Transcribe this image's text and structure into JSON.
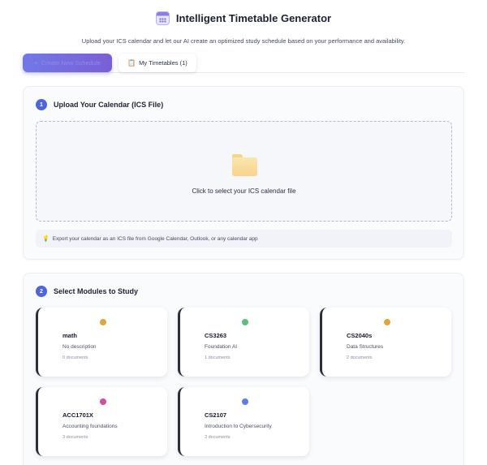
{
  "header": {
    "title": "Intelligent Timetable Generator",
    "subtitle": "Upload your ICS calendar and let our AI create an optimized study schedule based on your performance and availability."
  },
  "tabs": [
    {
      "label": "Create New Schedule",
      "icon": "plus-icon",
      "active": true
    },
    {
      "label": "My Timetables (1)",
      "icon": "clipboard-icon",
      "active": false
    }
  ],
  "upload": {
    "step": "1",
    "title": "Upload Your Calendar (ICS File)",
    "drop_label": "Click to select your ICS calendar file",
    "tip": "Export your calendar as an ICS file from Google Calendar, Outlook, or any calendar app"
  },
  "modules_section": {
    "step": "2",
    "title": "Select Modules to Study",
    "modules": [
      {
        "code": "math",
        "description": "No description",
        "documents": "0 documents",
        "color": "#e0a63a"
      },
      {
        "code": "CS3263",
        "description": "Foundation AI",
        "documents": "1 documents",
        "color": "#5fbf82"
      },
      {
        "code": "CS2040s",
        "description": "Data Structures",
        "documents": "2 documents",
        "color": "#e0a63a"
      },
      {
        "code": "ACC1701X",
        "description": "Accounting foundations",
        "documents": "3 documents",
        "color": "#d24f9c"
      },
      {
        "code": "CS2107",
        "description": "Introduction to Cybersecurity",
        "documents": "3 documents",
        "color": "#5b7fe6"
      }
    ]
  },
  "colors": {
    "accent": "#4e63dc",
    "tab_gradient_start": "#7278e6",
    "tab_gradient_end": "#7a5fd4"
  }
}
